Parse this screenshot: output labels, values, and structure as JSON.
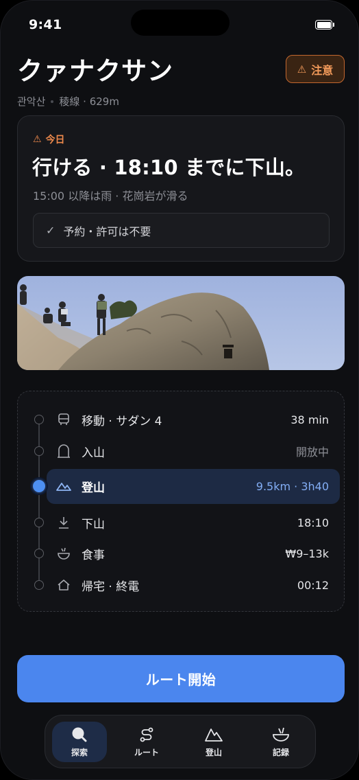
{
  "status_bar": {
    "time": "9:41"
  },
  "header": {
    "title": "クァナクサン",
    "subtitle_korean": "관악산",
    "subtitle_detail": "稜線 · 629m",
    "alert_label": "注意"
  },
  "today": {
    "tag": "今日",
    "verdict": "行ける · 18:10 までに下山。",
    "note": "15:00 以降は雨 · 花崗岩が滑る",
    "permit": "予約・許可は不要"
  },
  "timeline": [
    {
      "label": "移動 · サダン 4",
      "value": "38 min",
      "icon": "bus-icon",
      "active": false,
      "muted": false
    },
    {
      "label": "入山",
      "value": "開放中",
      "icon": "gate-icon",
      "active": false,
      "muted": true
    },
    {
      "label": "登山",
      "value": "9.5km · 3h40",
      "icon": "mountain-icon",
      "active": true,
      "muted": false
    },
    {
      "label": "下山",
      "value": "18:10",
      "icon": "descend-icon",
      "active": false,
      "muted": false
    },
    {
      "label": "食事",
      "value": "₩9–13k",
      "icon": "bowl-icon",
      "active": false,
      "muted": false
    },
    {
      "label": "帰宅 · 終電",
      "value": "00:12",
      "icon": "home-icon",
      "active": false,
      "muted": false
    }
  ],
  "start_button": "ルート開始",
  "tabs": [
    {
      "label": "探索",
      "icon": "search-icon",
      "active": true
    },
    {
      "label": "ルート",
      "icon": "route-icon",
      "active": false
    },
    {
      "label": "登山",
      "icon": "mountain-icon",
      "active": false
    },
    {
      "label": "記録",
      "icon": "bowl-icon",
      "active": false
    }
  ],
  "colors": {
    "background": "#0e0f12",
    "accent": "#4b86ee",
    "warning": "#ef8a4c",
    "active_row": "#1d2a44"
  }
}
